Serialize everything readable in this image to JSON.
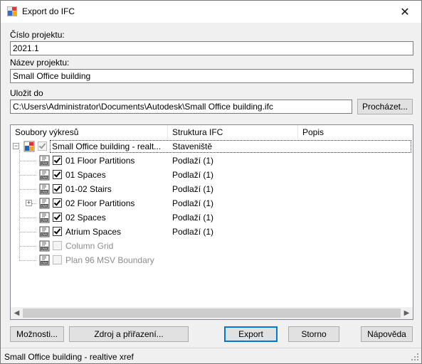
{
  "window": {
    "title": "Export do IFC"
  },
  "fields": {
    "project_number_label": "Číslo projektu:",
    "project_number_value": "2021.1",
    "project_name_label": "Název projektu:",
    "project_name_value": "Small Office building",
    "save_to_label": "Uložit do",
    "save_to_value": "C:\\Users\\Administrator\\Documents\\Autodesk\\Small Office building.ifc",
    "browse_label": "Procházet..."
  },
  "tree": {
    "columns": [
      "Soubory výkresů",
      "Struktura IFC",
      "Popis"
    ],
    "root": {
      "name": "Small Office building - realt...",
      "structure": "Staveniště"
    },
    "items": [
      {
        "name": "01 Floor Partitions",
        "structure": "Podlaží (1)",
        "checked": true,
        "enabled": true
      },
      {
        "name": "01 Spaces",
        "structure": "Podlaží (1)",
        "checked": true,
        "enabled": true
      },
      {
        "name": "01-02 Stairs",
        "structure": "Podlaží (1)",
        "checked": true,
        "enabled": true
      },
      {
        "name": "02 Floor Partitions",
        "structure": "Podlaží (1)",
        "checked": true,
        "enabled": true
      },
      {
        "name": "02 Spaces",
        "structure": "Podlaží (1)",
        "checked": true,
        "enabled": true
      },
      {
        "name": "Atrium Spaces",
        "structure": "Podlaží (1)",
        "checked": true,
        "enabled": true
      },
      {
        "name": "Column Grid",
        "structure": "",
        "checked": false,
        "enabled": false
      },
      {
        "name": "Plan 96 MSV Boundary",
        "structure": "",
        "checked": false,
        "enabled": false
      }
    ]
  },
  "buttons": {
    "options": "Možnosti...",
    "source": "Zdroj a přiřazení...",
    "export": "Export",
    "cancel": "Storno",
    "help": "Nápověda"
  },
  "status": {
    "text": "Small Office building - realtive xref"
  }
}
